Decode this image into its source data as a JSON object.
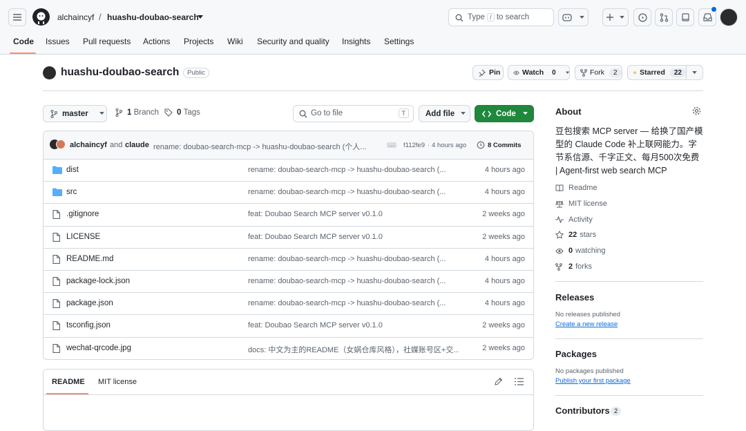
{
  "header": {
    "owner": "alchaincyf",
    "repo": "huashu-doubao-search",
    "search_placeholder": "Type / to search",
    "search_before": "Type",
    "search_key": "/",
    "search_after": "to search"
  },
  "tabs": [
    "Code",
    "Issues",
    "Pull requests",
    "Actions",
    "Projects",
    "Wiki",
    "Security and quality",
    "Insights",
    "Settings"
  ],
  "repo": {
    "name": "huashu-doubao-search",
    "visibility": "Public",
    "pin": "Pin",
    "watch": "Watch",
    "watch_count": "0",
    "fork": "Fork",
    "fork_count": "2",
    "starred": "Starred",
    "star_count": "22"
  },
  "toolbar": {
    "branch": "master",
    "branches": "1",
    "branches_label": "Branch",
    "tags": "0",
    "tags_label": "Tags",
    "goto_placeholder": "Go to file",
    "goto_key": "T",
    "add_file": "Add file",
    "code": "Code"
  },
  "commit": {
    "author": "alchaincyf",
    "and": "and",
    "coauthor": "claude",
    "message": "rename: doubao-search-mcp -> huashu-doubao-search (个人...",
    "hash": "f112fe9",
    "sep": "·",
    "time": "4 hours ago",
    "count": "8 Commits"
  },
  "files": [
    {
      "name": "dist",
      "type": "folder",
      "message": "rename: doubao-search-mcp -> huashu-doubao-search (...",
      "time": "4 hours ago"
    },
    {
      "name": "src",
      "type": "folder",
      "message": "rename: doubao-search-mcp -> huashu-doubao-search (...",
      "time": "4 hours ago"
    },
    {
      "name": ".gitignore",
      "type": "file",
      "message": "feat: Doubao Search MCP server v0.1.0",
      "time": "2 weeks ago"
    },
    {
      "name": "LICENSE",
      "type": "file",
      "message": "feat: Doubao Search MCP server v0.1.0",
      "time": "2 weeks ago"
    },
    {
      "name": "README.md",
      "type": "file",
      "message": "rename: doubao-search-mcp -> huashu-doubao-search (...",
      "time": "4 hours ago"
    },
    {
      "name": "package-lock.json",
      "type": "file",
      "message": "rename: doubao-search-mcp -> huashu-doubao-search (...",
      "time": "4 hours ago"
    },
    {
      "name": "package.json",
      "type": "file",
      "message": "rename: doubao-search-mcp -> huashu-doubao-search (...",
      "time": "4 hours ago"
    },
    {
      "name": "tsconfig.json",
      "type": "file",
      "message": "feat: Doubao Search MCP server v0.1.0",
      "time": "2 weeks ago"
    },
    {
      "name": "wechat-qrcode.jpg",
      "type": "file",
      "message": "docs: 中文为主的README（女娲仓库风格），社媒账号区+交...",
      "time": "2 weeks ago"
    }
  ],
  "readme": {
    "tab_readme": "README",
    "tab_license": "MIT license"
  },
  "about": {
    "title": "About",
    "description_lines": [
      "豆包搜索 MCP server — 给换了国产模",
      "型的 Claude Code 补上联网能力。字",
      "节系信源、千字正文、每月500次免费",
      "| Agent-first web search MCP"
    ],
    "readme": "Readme",
    "license": "MIT license",
    "activity": "Activity",
    "stars": "22",
    "stars_label": "stars",
    "watching": "0",
    "watching_label": "watching",
    "forks": "2",
    "forks_label": "forks"
  },
  "releases": {
    "title": "Releases",
    "none": "No releases published",
    "create": "Create a new release"
  },
  "packages": {
    "title": "Packages",
    "none": "No packages published",
    "publish": "Publish your first package"
  },
  "contributors": {
    "title": "Contributors",
    "count": "2"
  }
}
